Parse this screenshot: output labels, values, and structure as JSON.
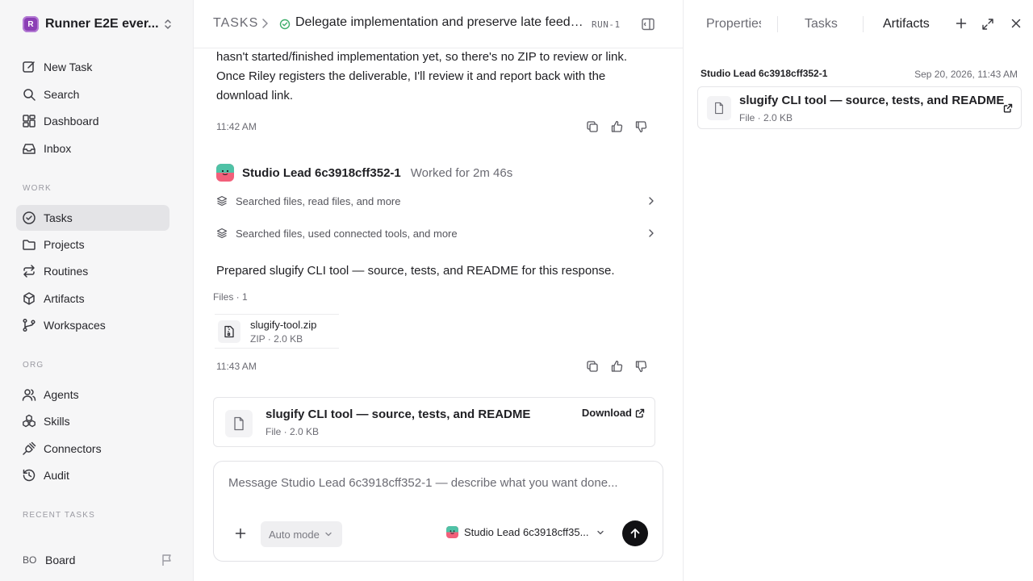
{
  "workspace": {
    "initial": "R",
    "name": "Runner E2E ever..."
  },
  "nav": {
    "new_task": "New Task",
    "search": "Search",
    "dashboard": "Dashboard",
    "inbox": "Inbox",
    "work_label": "WORK",
    "tasks": "Tasks",
    "projects": "Projects",
    "routines": "Routines",
    "artifacts": "Artifacts",
    "workspaces": "Workspaces",
    "org_label": "ORG",
    "agents": "Agents",
    "skills": "Skills",
    "connectors": "Connectors",
    "audit": "Audit",
    "recent_label": "RECENT TASKS",
    "board_initials": "BO",
    "board": "Board"
  },
  "header": {
    "root": "TASKS",
    "title": "Delegate implementation and preserve late feedback...",
    "run": "RUN-1"
  },
  "chat": {
    "intro_text": "hasn't started/finished implementation yet, so there's no ZIP to review or link. Once Riley registers the deliverable, I'll review it and report back with the download link.",
    "time_1": "11:42 AM",
    "agent_name": "Studio Lead 6c3918cff352-1",
    "worked": "Worked for 2m 46s",
    "step_1": "Searched files, read files, and more",
    "step_2": "Searched files, used connected tools, and more",
    "prepared": "Prepared slugify CLI tool — source, tests, and README for this response.",
    "files_label": "Files · 1",
    "zip_name": "slugify-tool.zip",
    "zip_meta": "ZIP · 2.0 KB",
    "time_2": "11:43 AM",
    "artifact_title": "slugify CLI tool — source, tests, and README",
    "artifact_meta": "File · 2.0 KB",
    "download": "Download"
  },
  "composer": {
    "placeholder": "Message Studio Lead 6c3918cff352-1 — describe what you want done...",
    "mode": "Auto mode",
    "agent": "Studio Lead 6c3918cff35..."
  },
  "panel": {
    "tab_properties": "Properties",
    "tab_tasks": "Tasks",
    "tab_artifacts": "Artifacts",
    "owner": "Studio Lead 6c3918cff352-1",
    "date": "Sep 20, 2026, 11:43 AM",
    "artifact_title": "slugify CLI tool — source, tests, and README",
    "artifact_meta": "File · 2.0 KB"
  },
  "colors": {
    "accent": "#8b3fb5",
    "success": "#3fae6b",
    "send": "#111114",
    "active_nav": "#e4e4e7"
  }
}
